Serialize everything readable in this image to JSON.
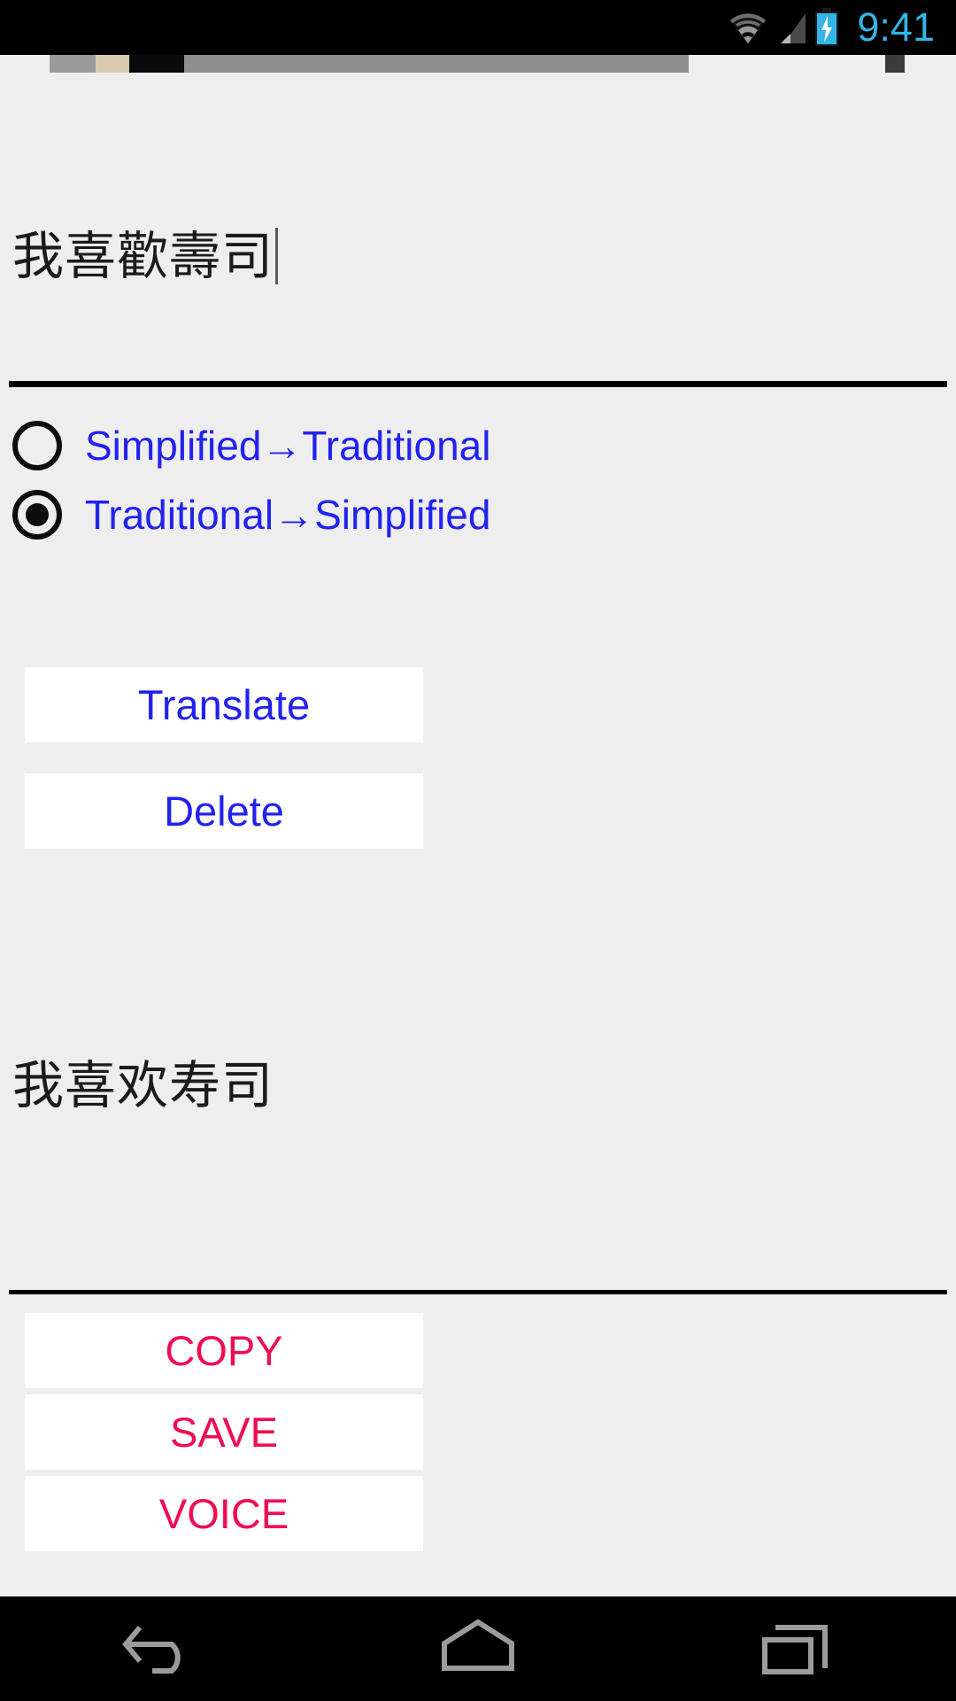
{
  "status_bar": {
    "time": "9:41",
    "time_color": "#33b5e5",
    "icons": [
      "wifi-icon",
      "signal-icon",
      "battery-charging-icon"
    ]
  },
  "app": {
    "source_input": {
      "value": "我喜歡壽司",
      "has_caret": true
    },
    "direction_options": [
      {
        "label": "Simplified→Traditional",
        "selected": false
      },
      {
        "label": "Traditional→Simplified",
        "selected": true
      }
    ],
    "primary_actions": [
      {
        "label": "Translate",
        "color": "#2222ee"
      },
      {
        "label": "Delete",
        "color": "#2222ee"
      }
    ],
    "result_output": {
      "value": "我喜欢寿司"
    },
    "secondary_actions": [
      {
        "label": "COPY",
        "color": "#ef0d50"
      },
      {
        "label": "SAVE",
        "color": "#ef0d50"
      },
      {
        "label": "VOICE",
        "color": "#ef0d50"
      }
    ]
  },
  "nav_bar": {
    "buttons": [
      "back-icon",
      "home-icon",
      "recents-icon"
    ]
  },
  "colors": {
    "accent_blue": "#2222ee",
    "accent_crimson": "#ef0d50",
    "background": "#eeeeee",
    "button_face": "#ffffff",
    "system_black": "#000000"
  }
}
